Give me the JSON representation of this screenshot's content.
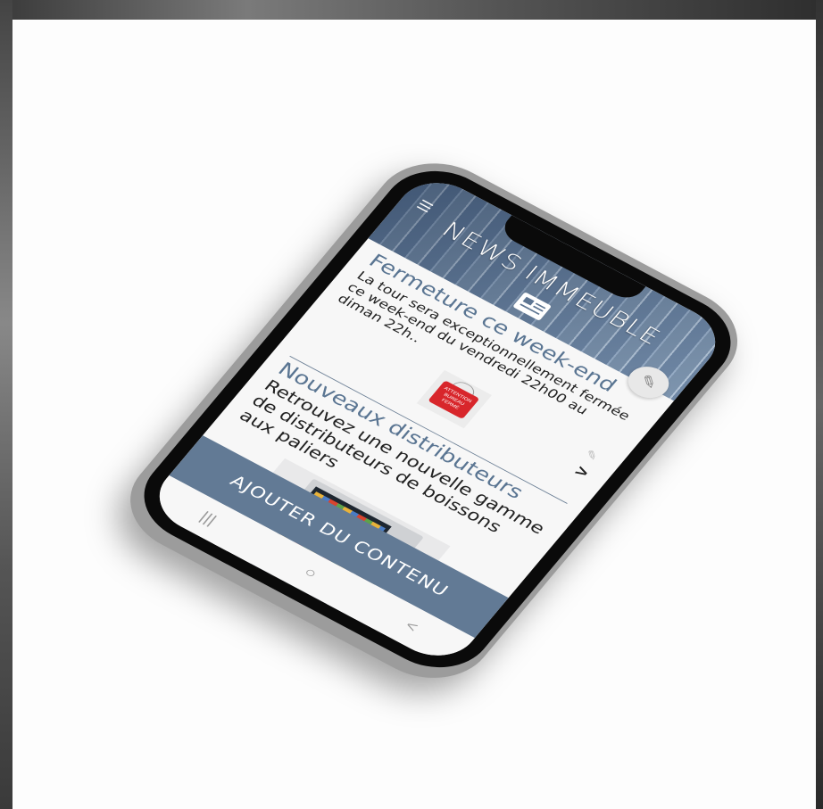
{
  "header": {
    "title": "NEWS IMMEUBLE",
    "menu_icon": "hamburger-icon",
    "section_icon": "newspaper-icon",
    "edit_icon": "pencil-icon"
  },
  "articles": [
    {
      "title": "Fermeture ce week-end",
      "body": "La tour sera exceptionnellement fermée ce week-end du vendredi 22h00 au diman 22h..",
      "thumb_icon": "attention-sign-icon",
      "thumb_text": "ATTENTION BUREAU FERMÉ",
      "chevron": ">"
    },
    {
      "title": "Nouveaux distributeurs",
      "body": "Retrouvez une nouvelle gamme de distributeurs de boissons aux paliers",
      "image_icon": "vending-machine-icon"
    }
  ],
  "cta": {
    "label": "AJOUTER DU CONTENU"
  },
  "navbar": {
    "recent": "|||",
    "home": "○",
    "back": "<"
  },
  "colors": {
    "accent": "#627a95",
    "title": "#5a7592",
    "sign": "#d8262b"
  }
}
